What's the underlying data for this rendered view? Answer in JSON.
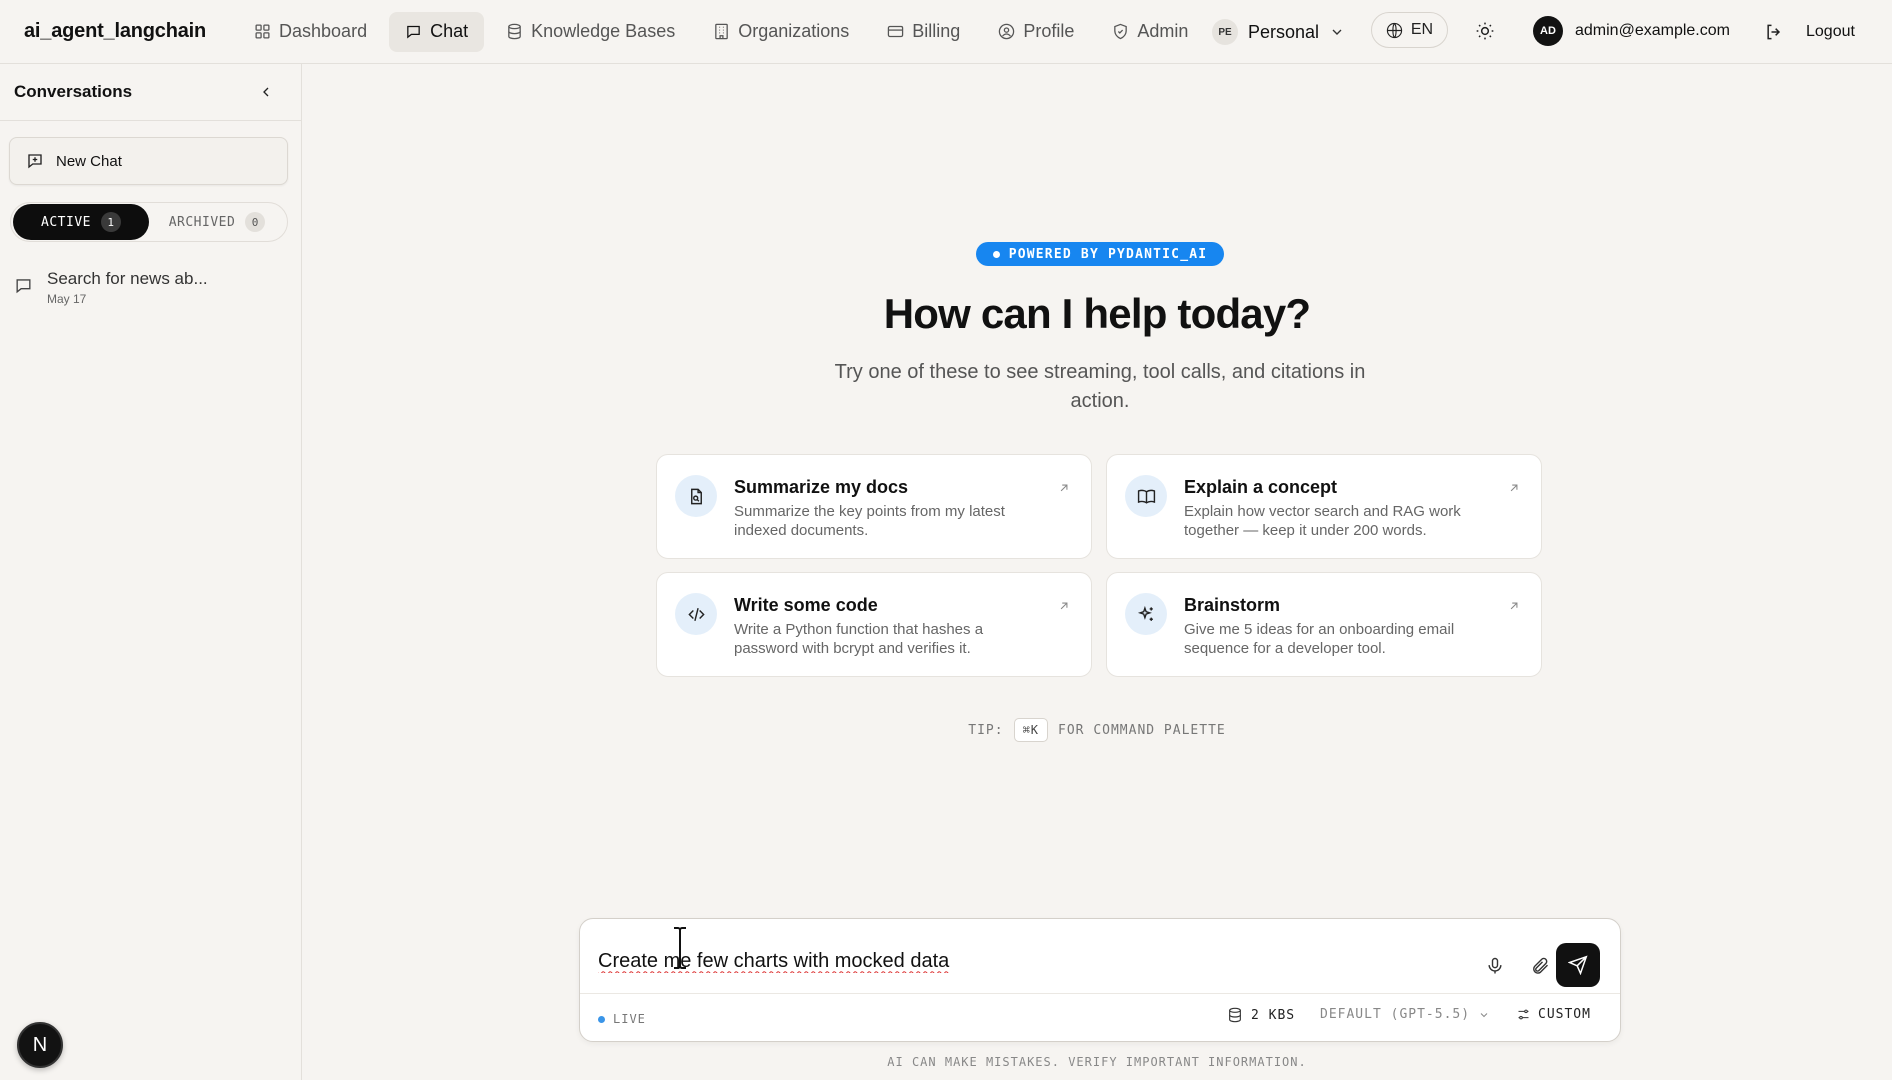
{
  "app": {
    "brand": "ai_agent_langchain"
  },
  "nav": {
    "items": [
      {
        "label": "Dashboard",
        "icon": "grid-icon"
      },
      {
        "label": "Chat",
        "icon": "chat-icon"
      },
      {
        "label": "Knowledge Bases",
        "icon": "database-icon"
      },
      {
        "label": "Organizations",
        "icon": "building-icon"
      },
      {
        "label": "Billing",
        "icon": "card-icon"
      },
      {
        "label": "Profile",
        "icon": "user-circle-icon"
      },
      {
        "label": "Admin",
        "icon": "shield-icon"
      }
    ],
    "active": "Chat",
    "workspace": {
      "badge": "PE",
      "label": "Personal"
    },
    "language": "EN",
    "user": {
      "initials": "AD",
      "email": "admin@example.com"
    },
    "logout_label": "Logout"
  },
  "sidebar": {
    "title": "Conversations",
    "new_chat_label": "New Chat",
    "tabs": [
      {
        "label": "ACTIVE",
        "count": "1"
      },
      {
        "label": "ARCHIVED",
        "count": "0"
      }
    ],
    "conversations": [
      {
        "title": "Search for news ab...",
        "date": "May 17"
      }
    ],
    "badge_letter": "N"
  },
  "main": {
    "pill": "POWERED BY PYDANTIC_AI",
    "headline": "How can I help today?",
    "subtitle": "Try one of these to see streaming, tool calls, and citations in action.",
    "cards": [
      {
        "title": "Summarize my docs",
        "desc": "Summarize the key points from my latest indexed documents.",
        "icon": "file-search-icon"
      },
      {
        "title": "Explain a concept",
        "desc": "Explain how vector search and RAG work together — keep it under 200 words.",
        "icon": "book-icon"
      },
      {
        "title": "Write some code",
        "desc": "Write a Python function that hashes a password with bcrypt and verifies it.",
        "icon": "code-icon"
      },
      {
        "title": "Brainstorm",
        "desc": "Give me 5 ideas for an onboarding email sequence for a developer tool.",
        "icon": "sparkles-icon"
      }
    ],
    "tip": {
      "prefix": "TIP:",
      "key": "⌘K",
      "suffix": "FOR COMMAND PALETTE"
    }
  },
  "composer": {
    "value": "Create me few charts with mocked data",
    "status": "LIVE",
    "kbs": "2 KBS",
    "model": "DEFAULT (GPT-5.5)",
    "custom": "CUSTOM"
  },
  "footer": {
    "disclaimer": "AI CAN MAKE MISTAKES. VERIFY IMPORTANT INFORMATION."
  },
  "colors": {
    "background": "#f6f4f1",
    "accent_blue": "#1786f0",
    "dark": "#111111"
  }
}
